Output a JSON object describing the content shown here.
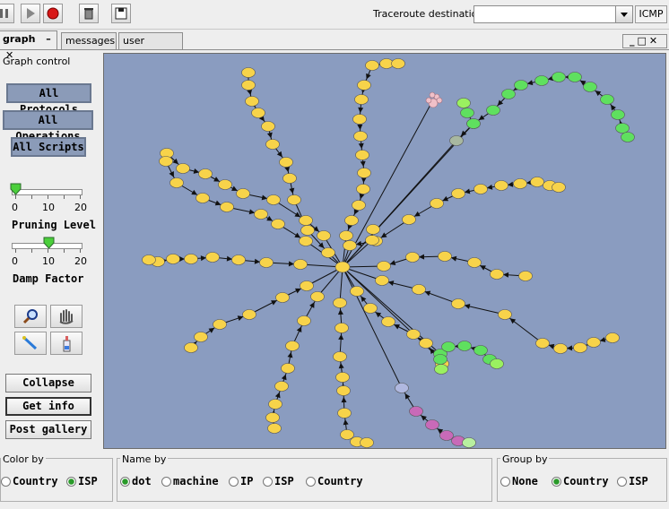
{
  "toolbar": {
    "traceroute_label": "Traceroute destination:",
    "traceroute_value": "",
    "protocol": "ICMP"
  },
  "tabs": [
    {
      "label": "graph",
      "active": true
    },
    {
      "label": "messages"
    },
    {
      "label": "user scripts"
    }
  ],
  "graph_control": {
    "title": "Graph control",
    "filters": [
      "All Protocols",
      "All Operations",
      "All Scripts"
    ],
    "pruning": {
      "label": "Pruning Level",
      "ticks": [
        "0",
        "10",
        "20"
      ],
      "value": 0
    },
    "damp": {
      "label": "Damp Factor",
      "ticks": [
        "0",
        "10",
        "20"
      ],
      "value": 10
    },
    "actions": [
      "Collapse",
      "Get info",
      "Post gallery"
    ]
  },
  "color_by": {
    "title": "Color by",
    "options": [
      "Country",
      "ISP"
    ],
    "selected": "ISP"
  },
  "name_by": {
    "title": "Name by",
    "options": [
      "dot",
      "machine",
      "IP",
      "ISP",
      "Country"
    ],
    "selected": "dot"
  },
  "group_by": {
    "title": "Group by",
    "options": [
      "None",
      "Country",
      "ISP"
    ],
    "selected": "Country"
  },
  "colors": {
    "graph_bg": "#8a9cc0",
    "node_yellow": "#f7d34a",
    "node_green": "#5fe05f",
    "node_purple": "#c86ab8"
  }
}
